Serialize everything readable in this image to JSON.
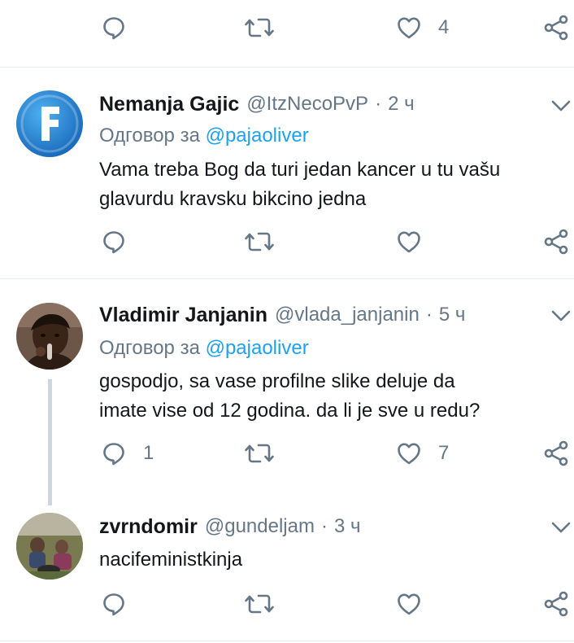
{
  "top_actions": {
    "reply_count": "",
    "retweet_count": "",
    "like_count": "4"
  },
  "tweets": [
    {
      "name": "Nemanja Gajic",
      "handle": "@ItzNecoPvP",
      "dot": "·",
      "time": "2 ч",
      "replying_prefix": "Одговор за",
      "replying_to": "@pajaoliver",
      "text_lines": [
        "Vama treba Bog da turi jedan kancer u tu vašu",
        "glavurdu kravsku bikcino jedna"
      ],
      "reply_count": "",
      "retweet_count": "",
      "like_count": "",
      "avatar": {
        "type": "logo",
        "letter": "F",
        "color": "#2a8fd9"
      }
    },
    {
      "name": "Vladimir Janjanin",
      "handle": "@vlada_janjanin",
      "dot": "·",
      "time": "5 ч",
      "replying_prefix": "Одговор за",
      "replying_to": "@pajaoliver",
      "text_lines": [
        "gospodjo, sa vase profilne slike deluje da",
        "imate vise od 12 godina. da li je sve u redu?"
      ],
      "reply_count": "1",
      "retweet_count": "",
      "like_count": "7",
      "avatar": {
        "type": "photo-portrait"
      }
    },
    {
      "name": "zvrndomir",
      "handle": "@gundeljam",
      "dot": "·",
      "time": "3 ч",
      "text_lines": [
        "nacifeministkinja"
      ],
      "reply_count": "",
      "retweet_count": "",
      "like_count": "",
      "avatar": {
        "type": "photo-outdoor"
      }
    }
  ],
  "icons": {
    "reply": "reply-icon",
    "retweet": "retweet-icon",
    "like": "heart-icon",
    "share": "share-icon",
    "more": "chevron-down-icon"
  },
  "colors": {
    "accent": "#1da1f2",
    "secondary_text": "#657786",
    "divider": "#e6ecf0",
    "thread_line": "#ccd6dd"
  }
}
